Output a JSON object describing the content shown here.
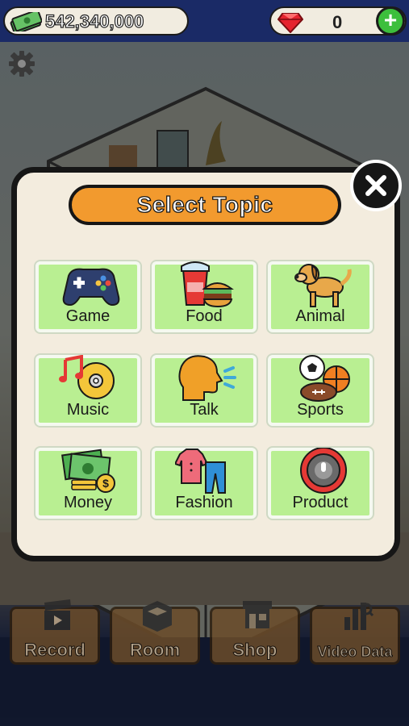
{
  "top_bar": {
    "money": "542,340,000",
    "gems": "0",
    "add_label": "+"
  },
  "modal": {
    "title": "Select Topic",
    "topics": [
      {
        "label": "Game",
        "icon": "gamepad-icon"
      },
      {
        "label": "Food",
        "icon": "food-icon"
      },
      {
        "label": "Animal",
        "icon": "dog-icon"
      },
      {
        "label": "Music",
        "icon": "music-icon"
      },
      {
        "label": "Talk",
        "icon": "talk-icon"
      },
      {
        "label": "Sports",
        "icon": "sports-icon"
      },
      {
        "label": "Money",
        "icon": "money-icon"
      },
      {
        "label": "Fashion",
        "icon": "fashion-icon"
      },
      {
        "label": "Product",
        "icon": "robot-vacuum-icon"
      }
    ]
  },
  "bottom_menu": [
    {
      "label": "Record",
      "icon": "clapperboard-icon"
    },
    {
      "label": "Room",
      "icon": "room-icon"
    },
    {
      "label": "Shop",
      "icon": "shop-icon"
    },
    {
      "label": "Video Data",
      "icon": "chart-icon"
    }
  ],
  "colors": {
    "accent": "#f29a2e",
    "tile": "#b9ef92",
    "panel": "#f3ecde",
    "top_bar": "#1a2a66"
  }
}
